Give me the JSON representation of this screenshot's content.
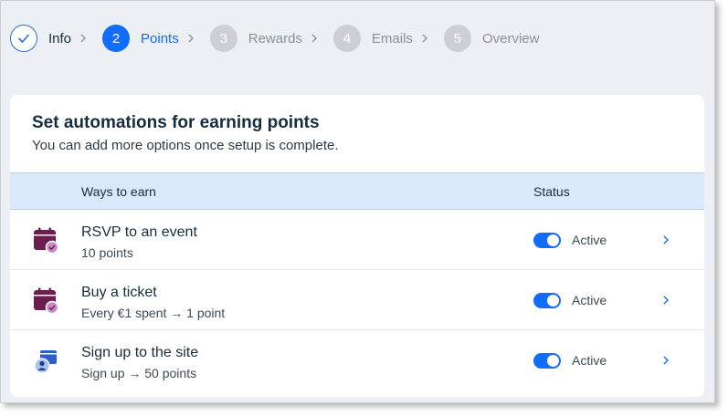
{
  "stepper": {
    "steps": [
      {
        "number": "",
        "label": "Info",
        "state": "done"
      },
      {
        "number": "2",
        "label": "Points",
        "state": "active"
      },
      {
        "number": "3",
        "label": "Rewards",
        "state": "todo"
      },
      {
        "number": "4",
        "label": "Emails",
        "state": "todo"
      },
      {
        "number": "5",
        "label": "Overview",
        "state": "todo"
      }
    ]
  },
  "card": {
    "title": "Set automations for earning points",
    "subtitle": "You can add more options once setup is complete.",
    "columns": {
      "ways": "Ways to earn",
      "status": "Status"
    },
    "rows": [
      {
        "icon": "calendar-check-icon",
        "title": "RSVP to an event",
        "subtitle": "10 points",
        "status": "Active",
        "enabled": true
      },
      {
        "icon": "calendar-check-icon",
        "title": "Buy a ticket",
        "subtitle": "Every €1 spent → 1 point",
        "status": "Active",
        "enabled": true
      },
      {
        "icon": "user-signup-icon",
        "title": "Sign up to the site",
        "subtitle": "Sign up → 50 points",
        "status": "Active",
        "enabled": true
      }
    ]
  },
  "colors": {
    "accent": "#116dff",
    "header_bg": "#d9e8fc",
    "calendar": "#6b1d4f",
    "check_badge": "#c88ac6",
    "signup_blue": "#2f5dc9"
  }
}
